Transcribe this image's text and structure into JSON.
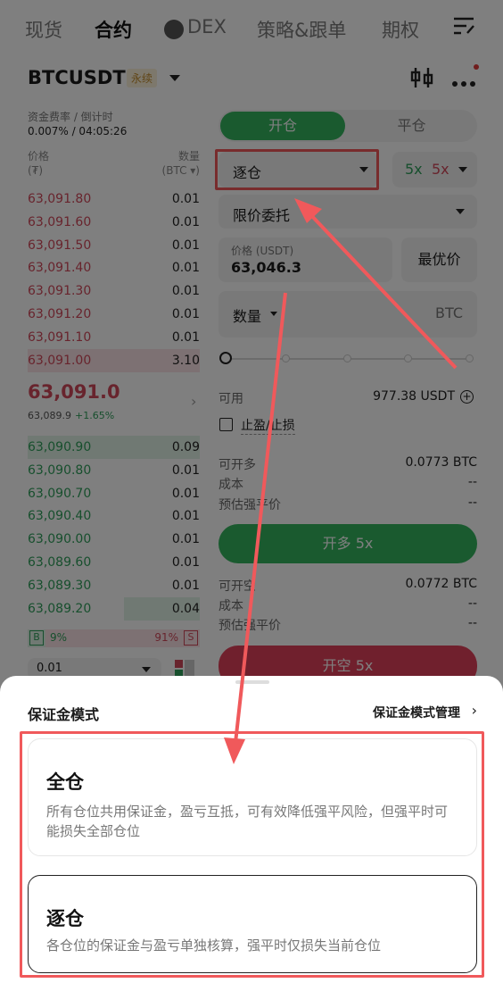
{
  "nav": {
    "spot": "现货",
    "futures": "合约",
    "dex": "DEX",
    "strategy": "策略&跟单",
    "options": "期权"
  },
  "header": {
    "symbol": "BTCUSDT",
    "tag": "永续"
  },
  "funding": {
    "label": "资金费率 / 倒计时",
    "value": "0.007% / 04:05:26"
  },
  "orderbook": {
    "price_label": "价格",
    "price_unit": "(₮)",
    "qty_label": "数量",
    "qty_unit": "(BTC ▾)",
    "asks": [
      {
        "price": "63,091.80",
        "qty": "0.01",
        "depth": 0
      },
      {
        "price": "63,091.60",
        "qty": "0.01",
        "depth": 0
      },
      {
        "price": "63,091.50",
        "qty": "0.01",
        "depth": 0
      },
      {
        "price": "63,091.40",
        "qty": "0.01",
        "depth": 0
      },
      {
        "price": "63,091.30",
        "qty": "0.01",
        "depth": 0
      },
      {
        "price": "63,091.20",
        "qty": "0.01",
        "depth": 0
      },
      {
        "price": "63,091.10",
        "qty": "0.01",
        "depth": 0
      },
      {
        "price": "63,091.00",
        "qty": "3.10",
        "depth": 1
      }
    ],
    "last_price": "63,091.0",
    "mark_price": "63,089.9",
    "change": "+1.65%",
    "bids": [
      {
        "price": "63,090.90",
        "qty": "0.09",
        "depth": 1
      },
      {
        "price": "63,090.80",
        "qty": "0.01",
        "depth": 0
      },
      {
        "price": "63,090.70",
        "qty": "0.01",
        "depth": 0
      },
      {
        "price": "63,090.40",
        "qty": "0.01",
        "depth": 0
      },
      {
        "price": "63,090.00",
        "qty": "0.01",
        "depth": 0
      },
      {
        "price": "63,089.60",
        "qty": "0.01",
        "depth": 0
      },
      {
        "price": "63,089.30",
        "qty": "0.01",
        "depth": 0
      },
      {
        "price": "63,089.20",
        "qty": "0.04",
        "depth": 0.44
      }
    ],
    "buy_label": "B",
    "buy_pct": "9%",
    "sell_pct": "91%",
    "sell_label": "S",
    "precision": "0.01"
  },
  "trade": {
    "open_tab": "开仓",
    "close_tab": "平仓",
    "margin_mode": "逐仓",
    "lev_long": "5x",
    "lev_short": "5x",
    "order_type": "限价委托",
    "price_label": "价格 (USDT)",
    "price_value": "63,046.3",
    "best_price": "最优价",
    "qty_label": "数量",
    "qty_unit": "BTC",
    "available_label": "可用",
    "available_value": "977.38 USDT",
    "tpsl_label": "止盈/止损",
    "long_open_label": "可开多",
    "long_open_value": "0.0773 BTC",
    "cost_label": "成本",
    "cost_value": "--",
    "liq_label": "预估强平价",
    "liq_value": "--",
    "long_button": "开多 5x",
    "short_open_label": "可开空",
    "short_open_value": "0.0772 BTC",
    "short_button": "开空 5x"
  },
  "sheet": {
    "title": "保证金模式",
    "manage": "保证金模式管理",
    "cross_title": "全仓",
    "cross_desc": "所有仓位共用保证金，盈亏互抵，可有效降低强平风险，但强平时可能损失全部仓位",
    "isolated_title": "逐仓",
    "isolated_desc": "各仓位的保证金与盈亏单独核算，强平时仅损失当前仓位"
  }
}
